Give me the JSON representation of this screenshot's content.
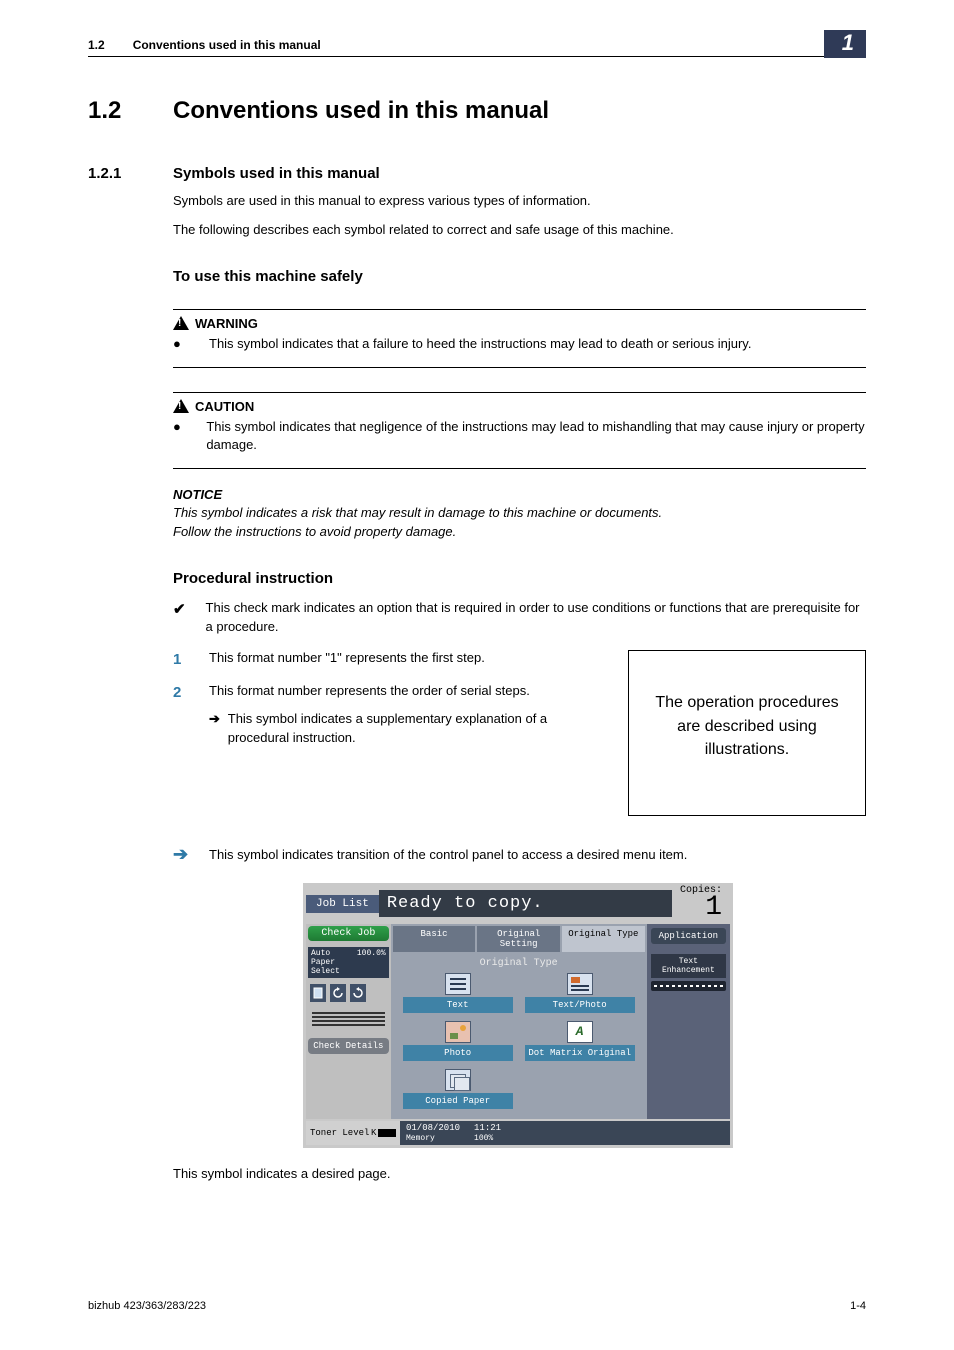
{
  "header": {
    "section_number": "1.2",
    "section_title": "Conventions used in this manual",
    "chapter_badge": "1"
  },
  "h1": {
    "number": "1.2",
    "title": "Conventions used in this manual"
  },
  "h2": {
    "number": "1.2.1",
    "title": "Symbols used in this manual"
  },
  "intro": {
    "p1": "Symbols are used in this manual to express various types of information.",
    "p2": "The following describes each symbol related to correct and safe usage of this machine."
  },
  "h3_safely": "To use this machine safely",
  "warning": {
    "label": "WARNING",
    "bullet": "This symbol indicates that a failure to heed the instructions may lead to death or serious injury."
  },
  "caution": {
    "label": "CAUTION",
    "bullet": "This symbol indicates that negligence of the instructions may lead to mishandling that may cause injury or property damage."
  },
  "notice": {
    "label": "NOTICE",
    "line1": "This symbol indicates a risk that may result in damage to this machine or documents.",
    "line2": "Follow the instructions to avoid property damage."
  },
  "h3_proc": "Procedural instruction",
  "proc": {
    "check": "This check mark indicates an option that is required in order to use conditions or functions that are prerequisite for a procedure.",
    "step1": "This format number \"1\" represents the first step.",
    "step2": "This format number represents the order of serial steps.",
    "sub_arrow": "This symbol indicates a supplementary explanation of a procedural instruction.",
    "callout": "The operation procedures are described using illustrations."
  },
  "transition_text": "This symbol indicates transition of the control panel to access a desired menu item.",
  "after_panel": "This symbol indicates a desired page.",
  "panel": {
    "job_list": "Job List",
    "ready": "Ready to copy.",
    "copies_label": "Copies:",
    "copies_value": "1",
    "check_job": "Check Job",
    "application": "Application",
    "auto_paper_label": "Auto Paper Select",
    "auto_paper_value": "100.0%",
    "check_details": "Check Details",
    "tabs": {
      "basic": "Basic",
      "orig_setting": "Original Setting",
      "orig_type": "Original Type"
    },
    "orig_type_title": "Original Type",
    "chips": {
      "text": "Text",
      "textphoto": "Text/Photo",
      "photo": "Photo",
      "dotmatrix": "Dot Matrix Original",
      "copied": "Copied Paper"
    },
    "text_enhancement": "Text Enhancement",
    "toner_label": "Toner Level",
    "toner_letter": "K",
    "date": "01/08/2010",
    "time": "11:21",
    "memory_label": "Memory",
    "memory_value": "100%"
  },
  "footer": {
    "left": "bizhub 423/363/283/223",
    "right": "1-4"
  }
}
